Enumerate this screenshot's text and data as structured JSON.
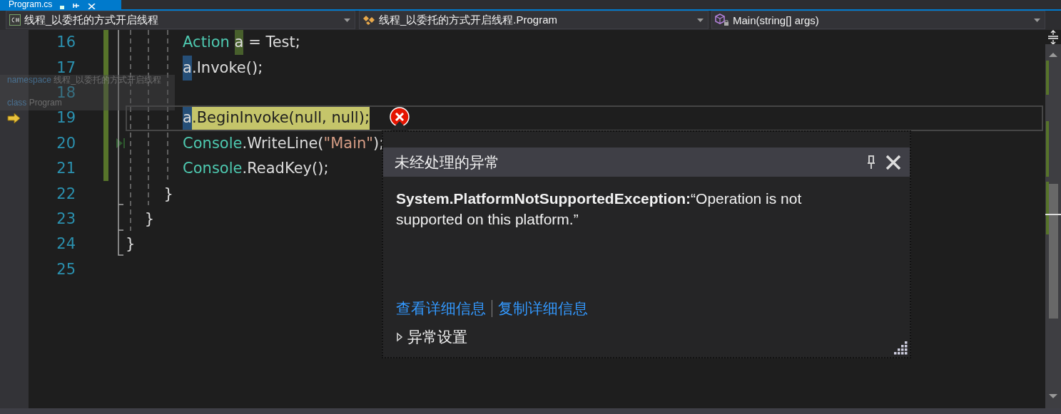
{
  "document_tab": {
    "title": "Program.cs",
    "selected": true
  },
  "nav_bar": [
    {
      "kind": "project",
      "text": "线程_以委托的方式开启线程"
    },
    {
      "kind": "class",
      "text": "线程_以委托的方式开启线程.Program"
    },
    {
      "kind": "method",
      "text": "Main(string[] args)"
    }
  ],
  "editor": {
    "lines": [
      {
        "number": "16",
        "changed": true,
        "current": false,
        "run_to_click": false,
        "tokens": [
          {
            "kind": "type",
            "text": "            Action"
          },
          {
            "kind": "definition",
            "text": " a"
          },
          {
            "kind": "plain",
            "text": " = Test;"
          }
        ]
      },
      {
        "number": "17",
        "changed": true,
        "current": false,
        "run_to_click": false,
        "tokens": [
          {
            "kind": "reference",
            "text": "            a"
          },
          {
            "kind": "plain",
            "text": ".Invoke();"
          }
        ]
      },
      {
        "number": "18",
        "changed": true,
        "current": false,
        "run_to_click": false
      },
      {
        "number": "19",
        "changed": true,
        "current": true,
        "run_to_click": false,
        "tokens": [
          {
            "kind": "reference",
            "text": "            a"
          },
          {
            "kind": "executing",
            "text": ".BeginInvoke(null, null);"
          }
        ]
      },
      {
        "number": "20",
        "changed": true,
        "current": false,
        "run_to_click": true,
        "tokens": [
          {
            "kind": "type",
            "text": "            Console"
          },
          {
            "kind": "plain",
            "text": ".WriteLine("
          },
          {
            "kind": "string",
            "text": "\"Main\""
          },
          {
            "kind": "plain",
            "text": ");"
          }
        ]
      },
      {
        "number": "21",
        "changed": true,
        "current": false,
        "run_to_click": false,
        "tokens": [
          {
            "kind": "type",
            "text": "            Console"
          },
          {
            "kind": "plain",
            "text": ".ReadKey();"
          }
        ]
      },
      {
        "number": "22",
        "changed": false,
        "current": false,
        "run_to_click": false,
        "tokens": [
          {
            "kind": "plain",
            "text": "        }"
          }
        ]
      },
      {
        "number": "23",
        "changed": false,
        "current": false,
        "run_to_click": false,
        "tokens": [
          {
            "kind": "plain",
            "text": "    }"
          }
        ]
      },
      {
        "number": "24",
        "changed": false,
        "current": false,
        "run_to_click": false,
        "tokens": [
          {
            "kind": "plain",
            "text": "}"
          }
        ]
      },
      {
        "number": "25",
        "changed": false,
        "current": false,
        "run_to_click": false
      }
    ]
  },
  "sticky_scroll": [
    {
      "keyword": "namespace",
      "name": "线程_以委托的方式开启线程"
    },
    {
      "keyword": "class",
      "name": "Program"
    }
  ],
  "exception_popup": {
    "title": "未经处理的异常",
    "message": "**System.PlatformNotSupportedException:**“Operation is not supported on this platform.”",
    "links": [
      "查看详细信息",
      "复制详细信息"
    ],
    "settings_label": "异常设置",
    "settings_expanded": false
  }
}
